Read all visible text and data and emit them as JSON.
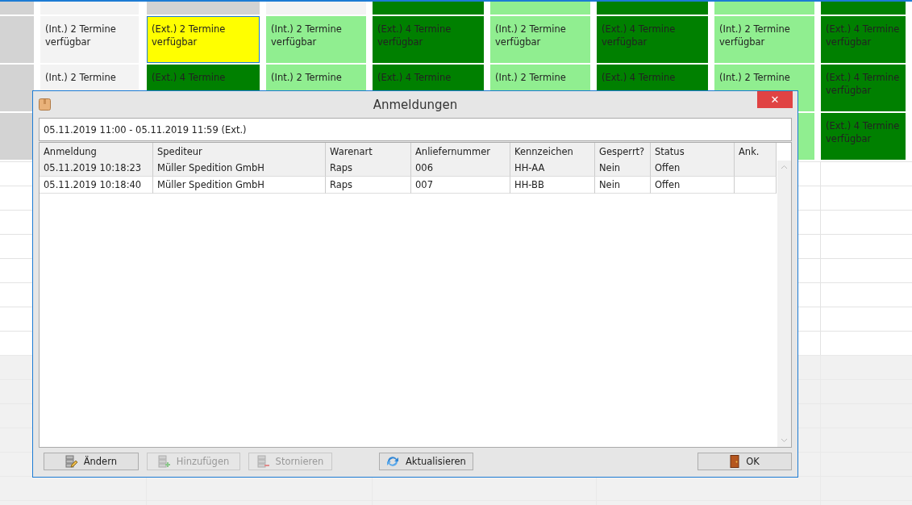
{
  "schedule": {
    "rows": [
      {
        "cells": [
          {
            "color": "#d3d3d3",
            "selected": false
          },
          {
            "color": "#f3f3f3",
            "selected": false
          },
          {
            "color": "#d3d3d3",
            "selected": false
          },
          {
            "color": "#f3f3f3",
            "selected": false
          },
          {
            "color": "#008000",
            "selected": false
          },
          {
            "color": "#90ee90",
            "selected": false
          },
          {
            "color": "#008000",
            "selected": false
          },
          {
            "color": "#90ee90",
            "selected": false
          },
          {
            "color": "#008000",
            "selected": false
          }
        ]
      },
      {
        "cells": [
          {
            "color": "#d3d3d3",
            "selected": false
          },
          {
            "text": "(Int.) 2 Termine verfügbar",
            "color": "#f3f3f3",
            "selected": false
          },
          {
            "text": "(Ext.) 2 Termine verfügbar",
            "color": "#ffff00",
            "selected": true
          },
          {
            "text": "(Int.) 2 Termine verfügbar",
            "color": "#90ee90",
            "selected": false
          },
          {
            "text": "(Ext.) 4 Termine verfügbar",
            "color": "#008000",
            "selected": false
          },
          {
            "text": "(Int.) 2 Termine verfügbar",
            "color": "#90ee90",
            "selected": false
          },
          {
            "text": "(Ext.) 4 Termine verfügbar",
            "color": "#008000",
            "selected": false
          },
          {
            "text": "(Int.) 2 Termine verfügbar",
            "color": "#90ee90",
            "selected": false
          },
          {
            "text": "(Ext.) 4 Termine verfügbar",
            "color": "#008000",
            "selected": false
          }
        ]
      },
      {
        "cells": [
          {
            "color": "#d3d3d3",
            "selected": false
          },
          {
            "text": "(Int.) 2 Termine",
            "color": "#f3f3f3",
            "selected": false
          },
          {
            "text": "(Ext.) 4 Termine",
            "color": "#008000",
            "selected": false
          },
          {
            "text": "(Int.) 2 Termine",
            "color": "#90ee90",
            "selected": false
          },
          {
            "text": "(Ext.) 4 Termine",
            "color": "#008000",
            "selected": false
          },
          {
            "text": "(Int.) 2 Termine",
            "color": "#90ee90",
            "selected": false
          },
          {
            "text": "(Ext.) 4 Termine",
            "color": "#008000",
            "selected": false
          },
          {
            "text": "(Int.) 2 Termine",
            "color": "#90ee90",
            "selected": false
          },
          {
            "text": "(Ext.) 4 Termine verfügbar",
            "color": "#008000",
            "selected": false
          }
        ]
      },
      {
        "cells": [
          {
            "color": "#d3d3d3",
            "selected": false
          },
          "",
          "",
          "",
          "",
          "",
          "",
          {
            "color": "#90ee90",
            "selected": false
          },
          {
            "text": "(Ext.) 4 Termine verfügbar",
            "color": "#008000",
            "selected": false
          }
        ]
      }
    ]
  },
  "dialog": {
    "title": "Anmeldungen",
    "close": "✕",
    "slot": "05.11.2019 11:00 - 05.11.2019 11:59 (Ext.)",
    "table": {
      "columns": [
        "Anmeldung",
        "Spediteur",
        "Warenart",
        "Anliefernummer",
        "Kennzeichen",
        "Gesperrt?",
        "Status",
        "Ank."
      ],
      "rows": [
        {
          "selected": true,
          "cells": [
            "05.11.2019 10:18:23",
            "Müller Spedition GmbH",
            "Raps",
            "006",
            "HH-AA",
            "Nein",
            "Offen"
          ]
        },
        {
          "selected": false,
          "cells": [
            "05.11.2019 10:18:40",
            "Müller Spedition GmbH",
            "Raps",
            "007",
            "HH-BB",
            "Nein",
            "Offen"
          ]
        }
      ]
    },
    "buttons": [
      {
        "kind": "edit",
        "label": "Ändern",
        "disabled": false
      },
      {
        "kind": "add",
        "label": "Hinzufügen",
        "disabled": true
      },
      {
        "kind": "cancel",
        "label": "Stornieren",
        "disabled": true
      },
      {
        "kind": "refresh",
        "label": "Aktualisieren",
        "disabled": false
      },
      {
        "kind": "exit",
        "label": "OK",
        "disabled": false
      }
    ]
  }
}
